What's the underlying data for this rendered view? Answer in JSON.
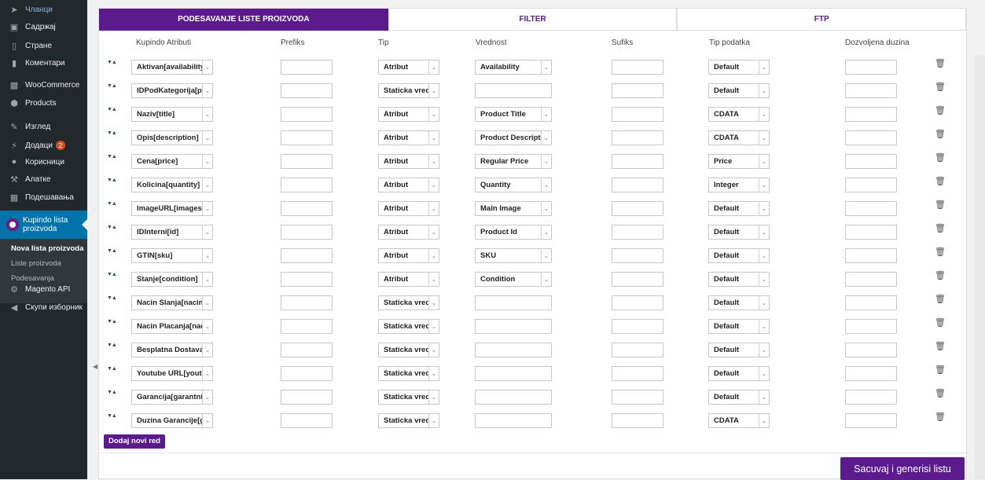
{
  "sidebar": {
    "items_top": [
      {
        "label": "Чланци",
        "icon": "pin-icon",
        "dim": true
      },
      {
        "label": "Садржај",
        "icon": "media-icon"
      },
      {
        "label": "Стране",
        "icon": "page-icon"
      },
      {
        "label": "Коментари",
        "icon": "comment-icon"
      },
      {
        "label": "WooCommerce",
        "icon": "woo-icon"
      },
      {
        "label": "Products",
        "icon": "archive-icon"
      },
      {
        "label": "Изглед",
        "icon": "brush-icon"
      },
      {
        "label": "Додаци",
        "icon": "plugin-icon",
        "badge": "2"
      },
      {
        "label": "Корисници",
        "icon": "user-icon"
      },
      {
        "label": "Алатке",
        "icon": "wrench-icon"
      },
      {
        "label": "Подешавања",
        "icon": "settings-icon"
      }
    ],
    "active": {
      "label": "Kupindo lista proizvoda",
      "icon": "kupindo-logo-icon"
    },
    "submenu": [
      "Nova lista proizvoda",
      "Liste proizvoda",
      "Podesavanja"
    ],
    "items_bottom": [
      {
        "label": "Magento API",
        "icon": "gear-icon"
      },
      {
        "label": "Скупи изборник",
        "icon": "collapse-icon"
      }
    ]
  },
  "tabs": [
    {
      "label": "PODESAVANJE LISTE PROIZVODA",
      "active": true
    },
    {
      "label": "FILTER",
      "active": false
    },
    {
      "label": "FTP",
      "active": false
    }
  ],
  "columns": {
    "attr": "Kupindo Atributi",
    "prefix": "Prefiks",
    "type": "Tip",
    "value": "Vrednost",
    "suffix": "Sufiks",
    "datatype": "Tip podatka",
    "maxlen": "Dozvoljena duzina"
  },
  "rows": [
    {
      "attr": "Aktivan[availability]",
      "type": "Atribut",
      "value": "Availability",
      "datatype": "Default"
    },
    {
      "attr": "IDPodKategorija[p",
      "type": "Staticka vrednost",
      "value": "",
      "datatype": "Default"
    },
    {
      "attr": "Naziv[title]",
      "type": "Atribut",
      "value": "Product Title",
      "datatype": "CDATA"
    },
    {
      "attr": "Opis[description]",
      "type": "Atribut",
      "value": "Product Description",
      "datatype": "CDATA"
    },
    {
      "attr": "Cena[price]",
      "type": "Atribut",
      "value": "Regular Price",
      "datatype": "Price"
    },
    {
      "attr": "Kolicina[quantity]",
      "type": "Atribut",
      "value": "Quantity",
      "datatype": "Integer"
    },
    {
      "attr": "ImageURL[images",
      "type": "Atribut",
      "value": "Main Image",
      "datatype": "Default"
    },
    {
      "attr": "IDInterni[id]",
      "type": "Atribut",
      "value": "Product Id",
      "datatype": "Default"
    },
    {
      "attr": "GTIN[sku]",
      "type": "Atribut",
      "value": "SKU",
      "datatype": "Default"
    },
    {
      "attr": "Stanje[condition]",
      "type": "Atribut",
      "value": "Condition",
      "datatype": "Default"
    },
    {
      "attr": "Nacin Slanja[nacin",
      "type": "Staticka vrednost",
      "value": "",
      "datatype": "Default"
    },
    {
      "attr": "Nacin Placanja[nac",
      "type": "Staticka vrednost",
      "value": "",
      "datatype": "Default"
    },
    {
      "attr": "Besplatna Dostava",
      "type": "Staticka vrednost",
      "value": "",
      "datatype": "Default"
    },
    {
      "attr": "Youtube URL[yout",
      "type": "Staticka vrednost",
      "value": "",
      "datatype": "Default"
    },
    {
      "attr": "Garancija[garantni",
      "type": "Staticka vrednost",
      "value": "",
      "datatype": "Default"
    },
    {
      "attr": "Duzina Garancije[g",
      "type": "Staticka vrednost",
      "value": "",
      "datatype": "CDATA"
    }
  ],
  "buttons": {
    "add_row": "Dodaj novi red",
    "save": "Sacuvaj i generisi listu"
  },
  "colors": {
    "brand": "#5b1b8c",
    "sidebar_bg": "#23282d",
    "sidebar_active": "#0073aa"
  }
}
